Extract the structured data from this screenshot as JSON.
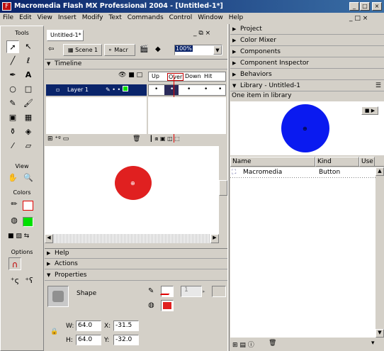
{
  "window": {
    "title": "Macromedia Flash MX Professional 2004 - [Untitled-1*]",
    "min": "_",
    "max": "□",
    "close": "×"
  },
  "menu": [
    "File",
    "Edit",
    "View",
    "Insert",
    "Modify",
    "Text",
    "Commands",
    "Control",
    "Window",
    "Help"
  ],
  "toolbox": {
    "title": "Tools",
    "view_label": "View",
    "colors_label": "Colors",
    "options_label": "Options"
  },
  "document": {
    "tab": "Untitled-1*",
    "scene": "Scene 1",
    "symbol": "Macr",
    "zoom": "100%"
  },
  "timeline": {
    "title": "Timeline",
    "layer": "Layer 1",
    "frames": [
      "Up",
      "Over",
      "Down",
      "Hit"
    ]
  },
  "panels_left": [
    "Help",
    "Actions",
    "Properties"
  ],
  "properties": {
    "type": "Shape",
    "w_label": "W:",
    "w": "64.0",
    "h_label": "H:",
    "h": "64.0",
    "x_label": "X:",
    "x": "-31.5",
    "y_label": "Y:",
    "y": "-32.0",
    "stroke_size": "1"
  },
  "right_panels": [
    "Project",
    "Color Mixer",
    "Components",
    "Component Inspector",
    "Behaviors"
  ],
  "library": {
    "title": "Library - Untitled-1",
    "count": "One item in library",
    "col_name": "Name",
    "col_kind": "Kind",
    "col_use": "Use",
    "item_name": "Macromedia",
    "item_kind": "Button"
  },
  "colors": {
    "fill": "#e02020",
    "fill_swatch": "#00e000",
    "preview": "#0a1af0",
    "title": "#0a246a"
  }
}
